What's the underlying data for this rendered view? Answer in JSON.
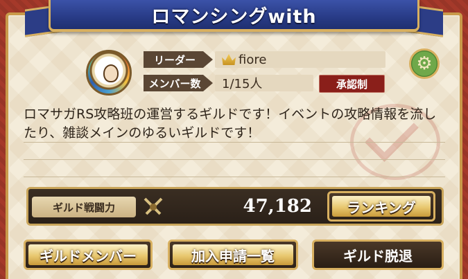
{
  "header": {
    "title": "ロマンシングwith"
  },
  "leader": {
    "label": "リーダー",
    "value": "fiore",
    "icon": "crown-icon"
  },
  "members": {
    "label": "メンバー数",
    "value": "1/15人"
  },
  "approval_badge": "承認制",
  "settings_icon": "gear-icon",
  "description": "ロマサガRS攻略班の運営するギルドです！イベントの攻略情報を流したり、雑談メインのゆるいギルドです！",
  "power": {
    "label": "ギルド戦闘力",
    "value": "47,182",
    "icon": "crossed-swords-icon"
  },
  "buttons": {
    "ranking": "ランキング",
    "guild_members": "ギルドメンバー",
    "join_requests": "加入申請一覧",
    "leave_guild": "ギルド脱退"
  },
  "colors": {
    "banner": "#283b86",
    "frame": "#a5392a",
    "gold": "#d8b060",
    "badge": "#8a1f1a"
  }
}
